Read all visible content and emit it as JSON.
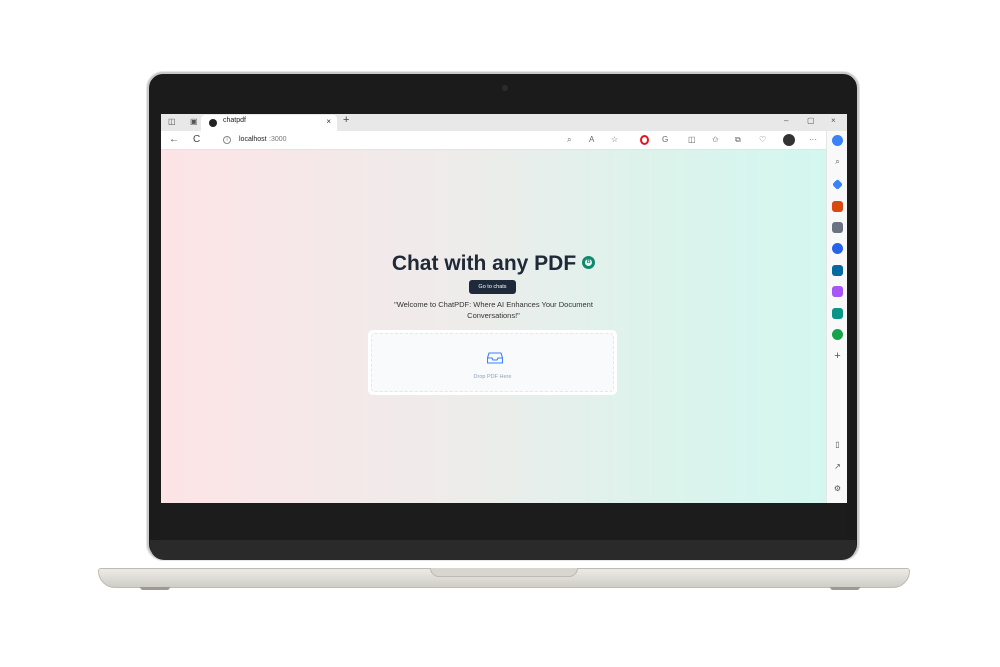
{
  "browser": {
    "tab_title": "chatpdf",
    "tab_close": "×",
    "new_tab": "+",
    "url_host": "localhost",
    "url_port": ":3000",
    "back": "←",
    "refresh": "C",
    "win_min": "–",
    "win_max": "▢",
    "win_close": "×",
    "more": "···"
  },
  "page": {
    "title": "Chat with any PDF",
    "badge": "B",
    "go_to_chats": "Go to chats",
    "tagline": "\"Welcome to ChatPDF: Where AI Enhances Your Document Conversations!\"",
    "drop_text": "Drop PDF Here"
  },
  "sidebar": {
    "add": "+"
  },
  "colors": {
    "accent": "#0f8a6e",
    "button": "#1e293b",
    "gradient_left": "#fde4e6",
    "gradient_right": "#d3f7ef"
  }
}
